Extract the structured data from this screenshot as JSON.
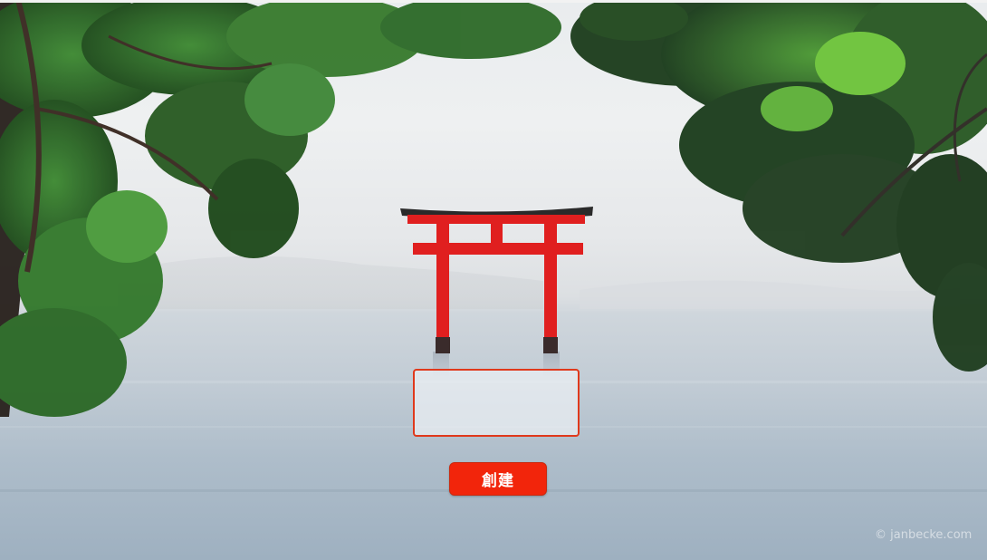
{
  "background": {
    "scene": "torii-gate-in-misty-lake",
    "torii_color": "#e01f1f",
    "foliage_color": "#2f6b2a"
  },
  "form": {
    "message_value": "",
    "create_label": "創建",
    "create_color": "#f2250b",
    "input_border_color": "#e0391c"
  },
  "credit": {
    "text": "© janbecke.com"
  }
}
